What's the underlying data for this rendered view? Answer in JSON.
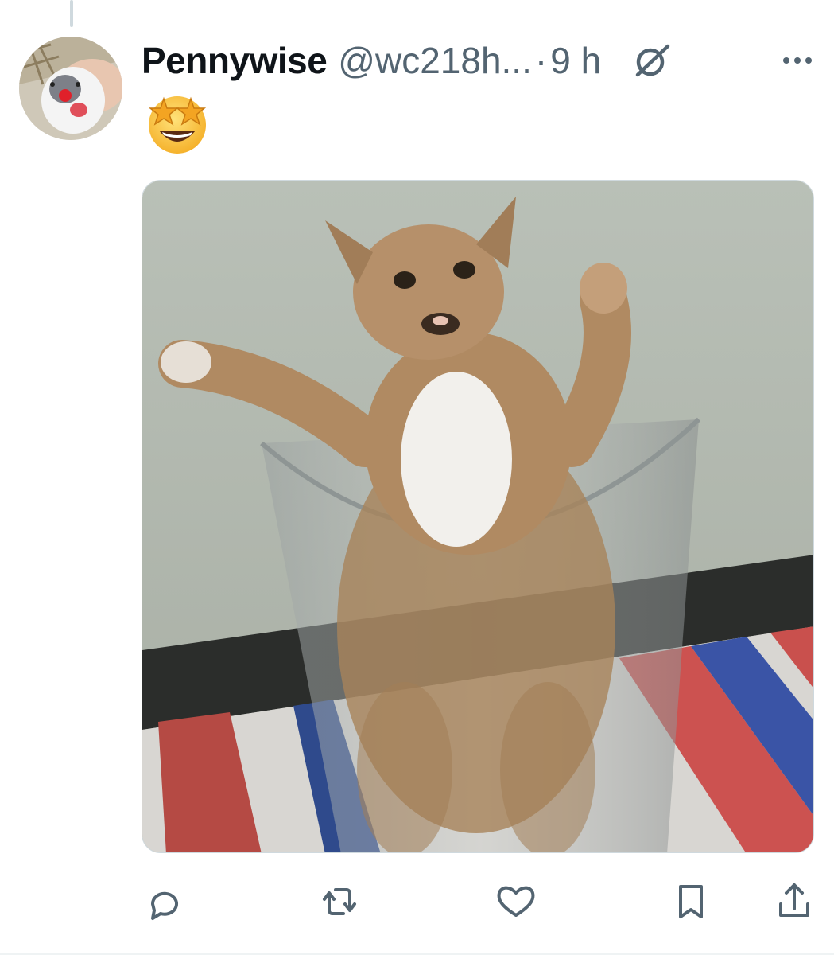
{
  "tweet": {
    "display_name": "Pennywise",
    "handle": "@wc218h...",
    "separator": "·",
    "time": "9 h",
    "body_emoji": "star-struck-emoji",
    "avatar": "kitten-avatar",
    "media": "photo-cat-in-plastic-cup"
  },
  "header_icons": [
    "grok-icon",
    "more-icon"
  ],
  "actions": [
    "reply-icon",
    "retweet-icon",
    "like-icon",
    "bookmark-icon",
    "share-icon"
  ],
  "colors": {
    "text_primary": "#0f1419",
    "text_secondary": "#536471",
    "border": "#cfd9de"
  }
}
